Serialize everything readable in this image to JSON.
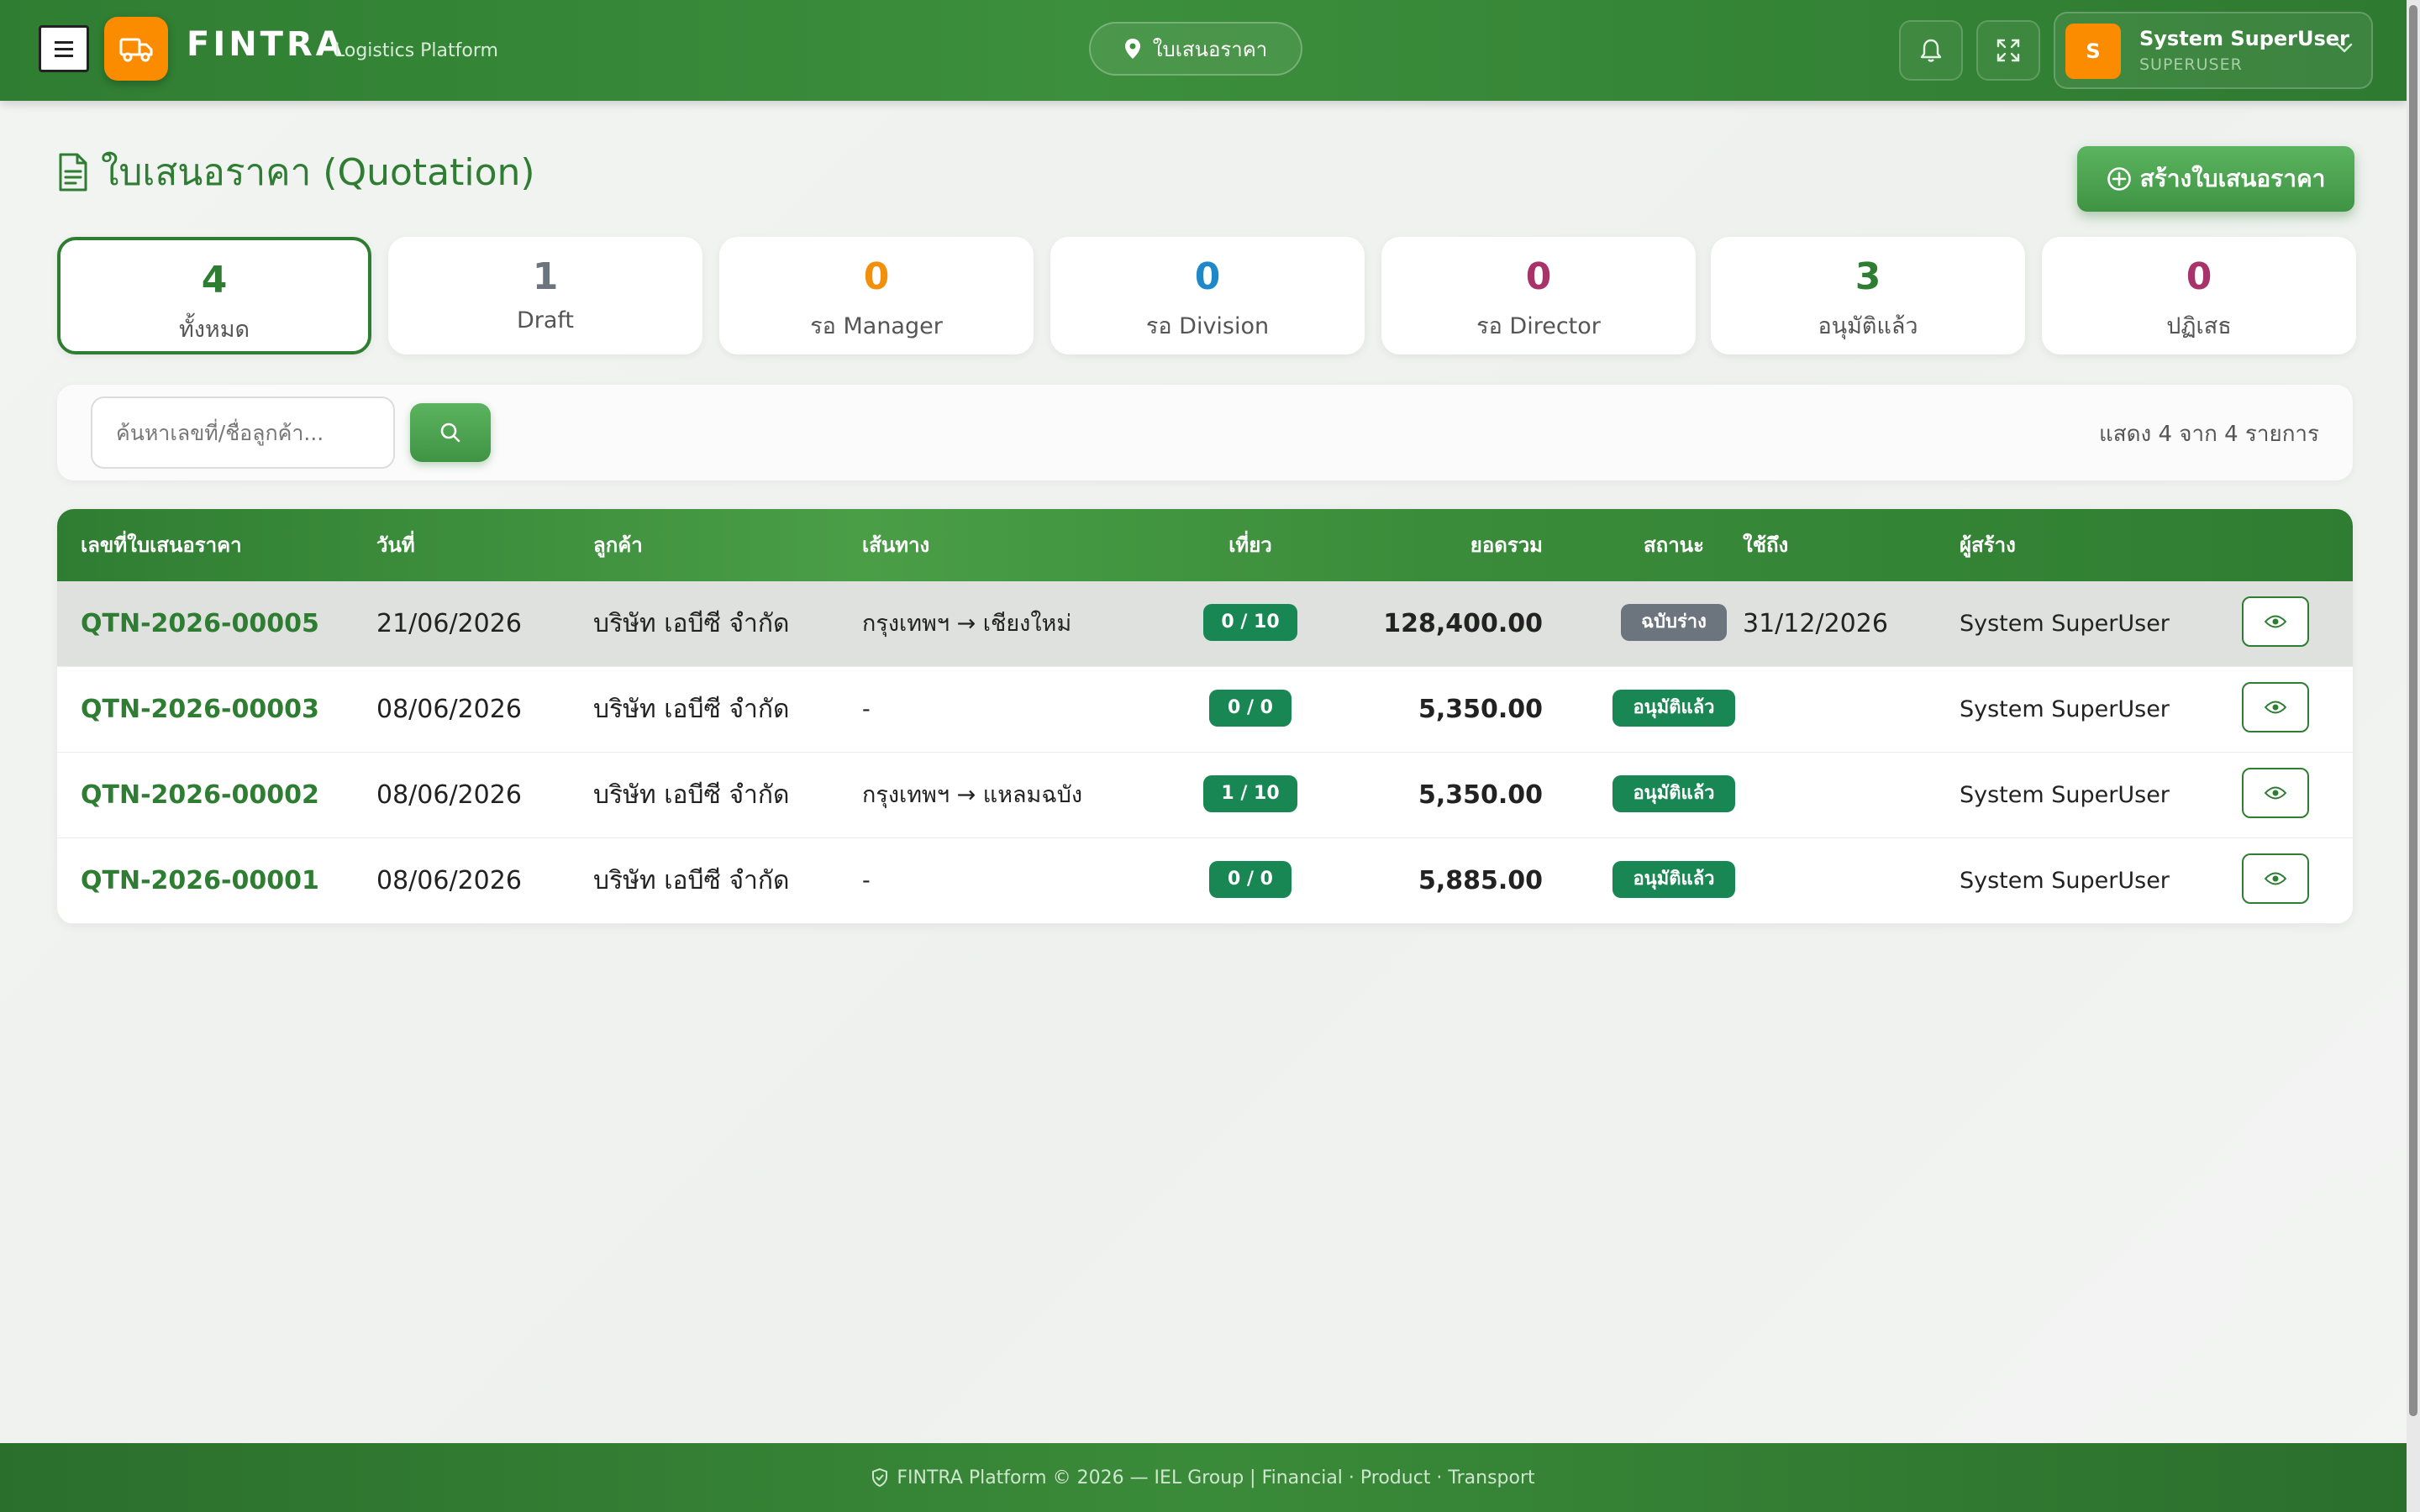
{
  "header": {
    "brand": "FINTRA",
    "brand_sub": "Logistics Platform",
    "location": "ใบเสนอราคา",
    "user_name": "System SuperUser",
    "user_role": "SUPERUSER",
    "avatar_initial": "S"
  },
  "page": {
    "title": "ใบเสนอราคา (Quotation)",
    "create_label": "สร้างใบเสนอราคา"
  },
  "stats": [
    {
      "value": "4",
      "label": "ทั้งหมด",
      "color": "#2e7d32"
    },
    {
      "value": "1",
      "label": "Draft",
      "color": "#6c757d"
    },
    {
      "value": "0",
      "label": "รอ Manager",
      "color": "#f0900c"
    },
    {
      "value": "0",
      "label": "รอ Division",
      "color": "#1e88c8"
    },
    {
      "value": "0",
      "label": "รอ Director",
      "color": "#a8326a"
    },
    {
      "value": "3",
      "label": "อนุมัติแล้ว",
      "color": "#2e7d32"
    },
    {
      "value": "0",
      "label": "ปฏิเสธ",
      "color": "#a8326a"
    }
  ],
  "search": {
    "placeholder": "ค้นหาเลขที่/ชื่อลูกค้า...",
    "count_text": "แสดง 4 จาก 4 รายการ"
  },
  "table": {
    "headers": [
      "เลขที่ใบเสนอราคา",
      "วันที่",
      "ลูกค้า",
      "เส้นทาง",
      "เที่ยว",
      "ยอดรวม",
      "สถานะ",
      "ใช้ถึง",
      "ผู้สร้าง"
    ],
    "rows": [
      {
        "no": "QTN-2026-00005",
        "date": "21/06/2026",
        "customer": "บริษัท เอบีซี จำกัด",
        "route": "กรุงเทพฯ → เชียงใหม่",
        "trips": "0 / 10",
        "total": "128,400.00",
        "status": "ฉบับร่าง",
        "valid_until": "31/12/2026",
        "creator": "System SuperUser"
      },
      {
        "no": "QTN-2026-00003",
        "date": "08/06/2026",
        "customer": "บริษัท เอบีซี จำกัด",
        "route": "-",
        "trips": "0 / 0",
        "total": "5,350.00",
        "status": "อนุมัติแล้ว",
        "valid_until": "",
        "creator": "System SuperUser"
      },
      {
        "no": "QTN-2026-00002",
        "date": "08/06/2026",
        "customer": "บริษัท เอบีซี จำกัด",
        "route": "กรุงเทพฯ → แหลมฉบัง",
        "trips": "1 / 10",
        "total": "5,350.00",
        "status": "อนุมัติแล้ว",
        "valid_until": "",
        "creator": "System SuperUser"
      },
      {
        "no": "QTN-2026-00001",
        "date": "08/06/2026",
        "customer": "บริษัท เอบีซี จำกัด",
        "route": "-",
        "trips": "0 / 0",
        "total": "5,885.00",
        "status": "อนุมัติแล้ว",
        "valid_until": "",
        "creator": "System SuperUser"
      }
    ]
  },
  "footer": {
    "text": "FINTRA Platform © 2026 — IEL Group | Financial · Product · Transport"
  },
  "icons": {
    "logo": "truck-icon",
    "location": "map-pin-icon",
    "notify": "bell-icon",
    "fullscreen": "expand-icon",
    "title": "document-icon",
    "create": "plus-circle-icon",
    "search": "search-icon",
    "view": "eye-icon",
    "footer": "shield-icon"
  },
  "colors": {
    "brand_green": "#2e7d32",
    "accent_orange": "#fb8c00",
    "status_green": "#198754",
    "status_gray": "#6c757d"
  }
}
